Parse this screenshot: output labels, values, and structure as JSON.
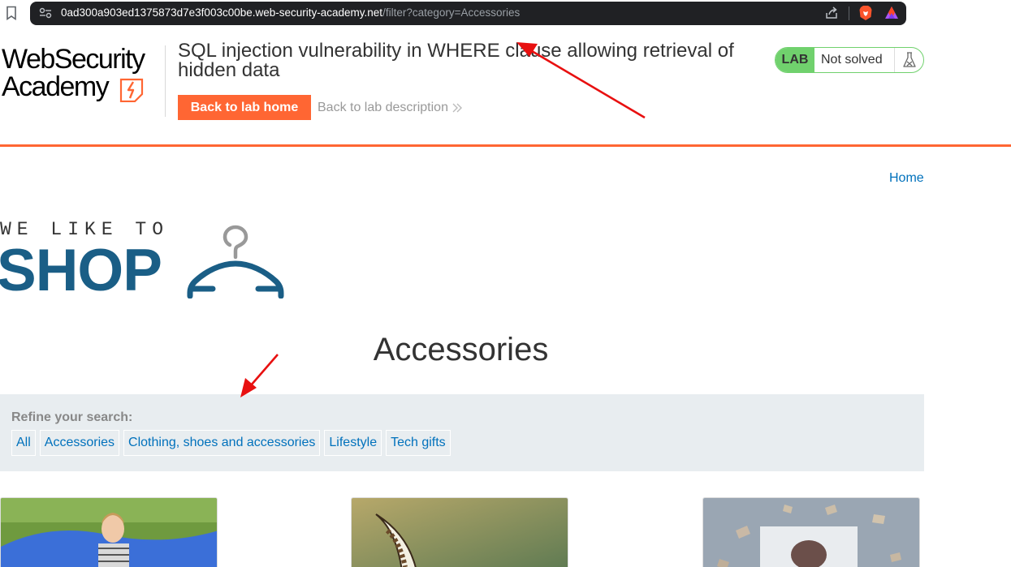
{
  "browser": {
    "url_domain": "0ad300a903ed1375873d7e3f003c00be.web-security-academy.net",
    "url_path": "/filter?category=Accessories"
  },
  "lab_header": {
    "logo_line1": "WebSecurity",
    "logo_line2": "Academy",
    "title": "SQL injection vulnerability in WHERE clause allowing retrieval of hidden data",
    "back_home_label": "Back to lab home",
    "back_description_label": "Back to lab description",
    "lab_badge": "LAB",
    "status": "Not solved"
  },
  "nav": {
    "home_label": "Home"
  },
  "shop_logo": {
    "tagline": "WE LIKE TO",
    "word": "SHOP"
  },
  "page": {
    "category_heading": "Accessories"
  },
  "filter": {
    "refine_label": "Refine your search:",
    "links": [
      "All",
      "Accessories",
      "Clothing, shoes and accessories",
      "Lifestyle",
      "Tech gifts"
    ]
  },
  "colors": {
    "accent": "#ff6633",
    "link": "#0071bc",
    "lab_green": "#70d16d",
    "shop_blue": "#1a5e86",
    "annotation": "#e81010"
  },
  "icons": [
    "bookmark-icon",
    "site-info-icon",
    "share-icon",
    "brave-icon",
    "rewards-icon",
    "chevron-right-icon",
    "flask-icon",
    "hanger-icon"
  ]
}
